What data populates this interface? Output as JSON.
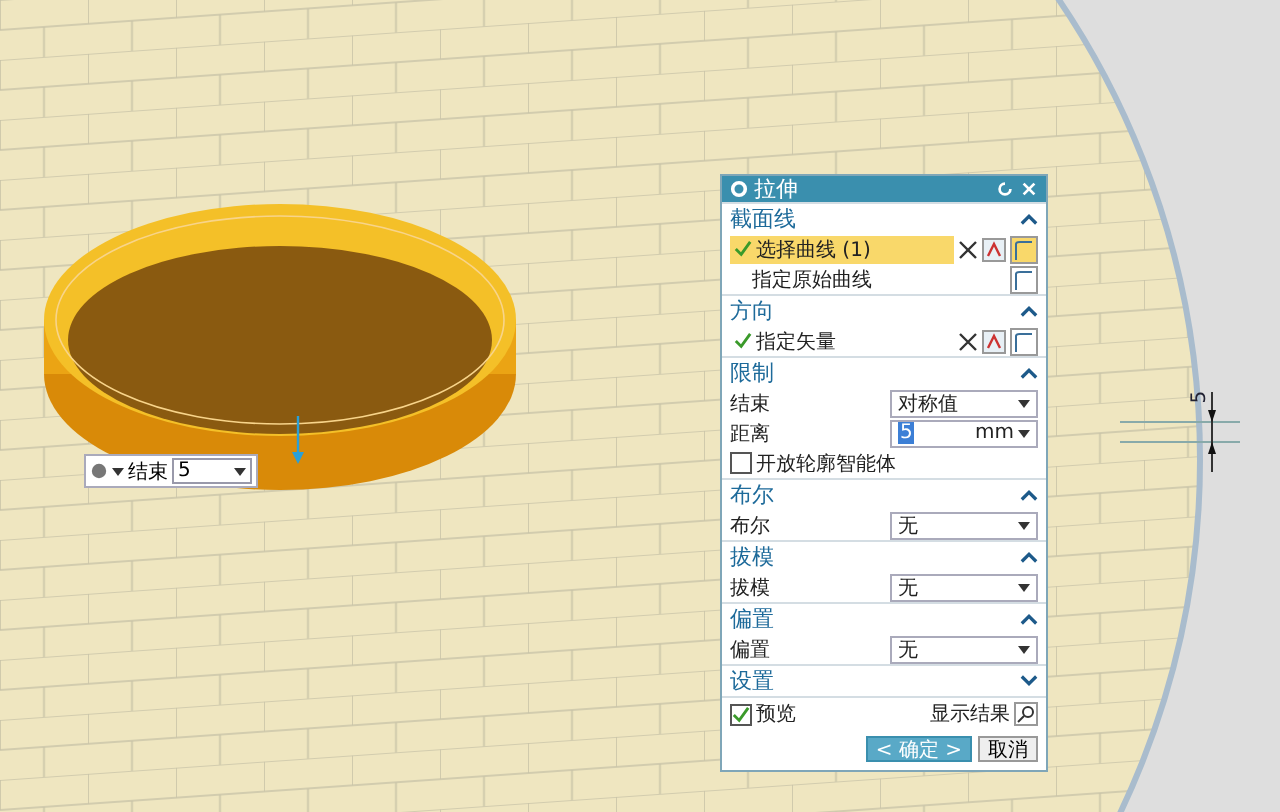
{
  "viewport": {
    "dimension_label": "5",
    "quick_widget": {
      "label": "结束",
      "value": "5"
    }
  },
  "dialog": {
    "title": "拉伸",
    "sections": [
      {
        "title": "截面线",
        "expanded": true,
        "rows": [
          {
            "kind": "pick",
            "label": "选择曲线 (1)",
            "checked": true,
            "selected": true
          },
          {
            "kind": "pick",
            "label": "指定原始曲线",
            "checked": false,
            "selected": false
          }
        ]
      },
      {
        "title": "方向",
        "expanded": true,
        "rows": [
          {
            "kind": "pick",
            "label": "指定矢量",
            "checked": true,
            "selected": false
          }
        ]
      },
      {
        "title": "限制",
        "expanded": true,
        "rows": [
          {
            "kind": "dropdown",
            "label": "结束",
            "value": "对称值"
          },
          {
            "kind": "number",
            "label": "距离",
            "value": "5",
            "unit": "mm"
          },
          {
            "kind": "checkbox",
            "label": "开放轮廓智能体",
            "checked": false
          }
        ]
      },
      {
        "title": "布尔",
        "expanded": true,
        "rows": [
          {
            "kind": "dropdown",
            "label": "布尔",
            "value": "无"
          }
        ]
      },
      {
        "title": "拔模",
        "expanded": true,
        "rows": [
          {
            "kind": "dropdown",
            "label": "拔模",
            "value": "无"
          }
        ]
      },
      {
        "title": "偏置",
        "expanded": true,
        "rows": [
          {
            "kind": "dropdown",
            "label": "偏置",
            "value": "无"
          }
        ]
      },
      {
        "title": "设置",
        "expanded": false
      }
    ],
    "preview": {
      "label": "预览",
      "checked": true
    },
    "show_result": "显示结果",
    "ok": "< 确定 >",
    "cancel": "取消"
  }
}
